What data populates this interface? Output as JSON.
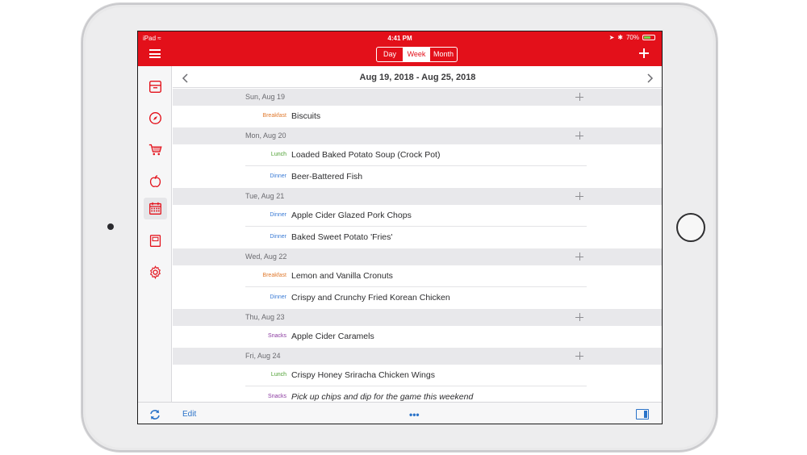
{
  "colors": {
    "brand_red": "#e3101a",
    "breakfast": "#e07a2e",
    "lunch": "#4a9e2e",
    "dinner": "#3a7bd5",
    "snacks": "#8b3aa0",
    "link_blue": "#2a73c9"
  },
  "status_bar": {
    "device": "iPad",
    "time": "4:41 PM",
    "battery": "70%",
    "battery_level": 0.7
  },
  "nav": {
    "view_options": [
      "Day",
      "Week",
      "Month"
    ],
    "selected_view": "Week"
  },
  "sidebar": {
    "items": [
      {
        "icon": "archive-box-icon",
        "name": "recipes"
      },
      {
        "icon": "compass-icon",
        "name": "browse"
      },
      {
        "icon": "shopping-cart-icon",
        "name": "groceries"
      },
      {
        "icon": "apple-icon",
        "name": "pantry"
      },
      {
        "icon": "calendar-icon",
        "name": "meal-planner",
        "active": true
      },
      {
        "icon": "notebook-icon",
        "name": "menus"
      },
      {
        "icon": "gear-icon",
        "name": "settings"
      }
    ]
  },
  "week": {
    "title": "Aug 19, 2018 - Aug 25, 2018",
    "days": [
      {
        "label": "Sun, Aug 19",
        "meals": [
          {
            "type": "Breakfast",
            "name": "Biscuits"
          }
        ]
      },
      {
        "label": "Mon, Aug 20",
        "meals": [
          {
            "type": "Lunch",
            "name": "Loaded Baked Potato Soup (Crock Pot)"
          },
          {
            "type": "Dinner",
            "name": "Beer-Battered Fish"
          }
        ]
      },
      {
        "label": "Tue, Aug 21",
        "meals": [
          {
            "type": "Dinner",
            "name": "Apple Cider Glazed Pork Chops"
          },
          {
            "type": "Dinner",
            "name": "Baked Sweet Potato 'Fries'"
          }
        ]
      },
      {
        "label": "Wed, Aug 22",
        "meals": [
          {
            "type": "Breakfast",
            "name": "Lemon and Vanilla Cronuts"
          },
          {
            "type": "Dinner",
            "name": "Crispy and Crunchy Fried Korean Chicken"
          }
        ]
      },
      {
        "label": "Thu, Aug 23",
        "meals": [
          {
            "type": "Snacks",
            "name": "Apple Cider Caramels"
          }
        ]
      },
      {
        "label": "Fri, Aug 24",
        "meals": [
          {
            "type": "Lunch",
            "name": "Crispy Honey Sriracha Chicken Wings"
          },
          {
            "type": "Snacks",
            "name": "Pick up chips and dip for the game this weekend",
            "note": true
          }
        ]
      }
    ]
  },
  "bottom_bar": {
    "edit_label": "Edit",
    "more_label": "•••"
  }
}
